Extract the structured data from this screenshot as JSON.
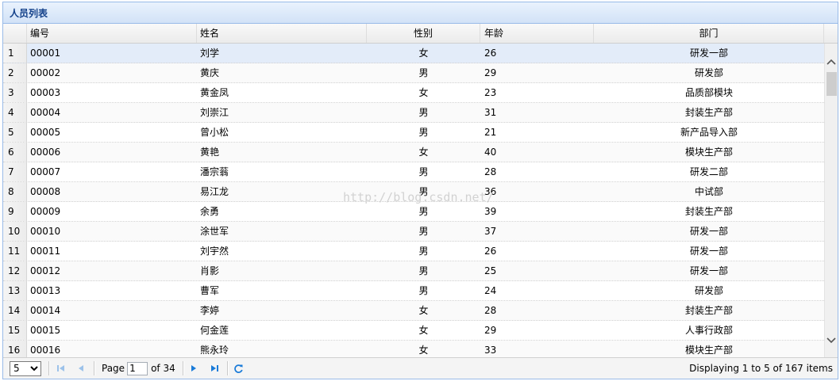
{
  "panel": {
    "title": "人员列表"
  },
  "columns": [
    {
      "key": "num",
      "label": ""
    },
    {
      "key": "id",
      "label": "编号"
    },
    {
      "key": "name",
      "label": "姓名"
    },
    {
      "key": "gender",
      "label": "性别"
    },
    {
      "key": "age",
      "label": "年龄"
    },
    {
      "key": "dept",
      "label": "部门"
    }
  ],
  "rows": [
    {
      "num": "1",
      "id": "00001",
      "name": "刘学",
      "gender": "女",
      "age": "26",
      "dept": "研发一部"
    },
    {
      "num": "2",
      "id": "00002",
      "name": "黄庆",
      "gender": "男",
      "age": "29",
      "dept": "研发部"
    },
    {
      "num": "3",
      "id": "00003",
      "name": "黄金凤",
      "gender": "女",
      "age": "23",
      "dept": "品质部模块"
    },
    {
      "num": "4",
      "id": "00004",
      "name": "刘崇江",
      "gender": "男",
      "age": "31",
      "dept": "封装生产部"
    },
    {
      "num": "5",
      "id": "00005",
      "name": "曾小松",
      "gender": "男",
      "age": "21",
      "dept": "新产品导入部"
    },
    {
      "num": "6",
      "id": "00006",
      "name": "黄艳",
      "gender": "女",
      "age": "40",
      "dept": "模块生产部"
    },
    {
      "num": "7",
      "id": "00007",
      "name": "潘宗蓊",
      "gender": "男",
      "age": "28",
      "dept": "研发二部"
    },
    {
      "num": "8",
      "id": "00008",
      "name": "易江龙",
      "gender": "男",
      "age": "36",
      "dept": "中试部"
    },
    {
      "num": "9",
      "id": "00009",
      "name": "余勇",
      "gender": "男",
      "age": "39",
      "dept": "封装生产部"
    },
    {
      "num": "10",
      "id": "00010",
      "name": "涂世军",
      "gender": "男",
      "age": "37",
      "dept": "研发一部"
    },
    {
      "num": "11",
      "id": "00011",
      "name": "刘宇然",
      "gender": "男",
      "age": "26",
      "dept": "研发一部"
    },
    {
      "num": "12",
      "id": "00012",
      "name": "肖影",
      "gender": "男",
      "age": "25",
      "dept": "研发一部"
    },
    {
      "num": "13",
      "id": "00013",
      "name": "曹军",
      "gender": "男",
      "age": "24",
      "dept": "研发部"
    },
    {
      "num": "14",
      "id": "00014",
      "name": "李婷",
      "gender": "女",
      "age": "28",
      "dept": "封装生产部"
    },
    {
      "num": "15",
      "id": "00015",
      "name": "何金莲",
      "gender": "女",
      "age": "29",
      "dept": "人事行政部"
    },
    {
      "num": "16",
      "id": "00016",
      "name": "熊永玲",
      "gender": "女",
      "age": "33",
      "dept": "模块生产部"
    }
  ],
  "selected_row": 0,
  "pager": {
    "page_size": "5",
    "page_size_options": [
      "5"
    ],
    "page_label": "Page",
    "page_value": "1",
    "of_label": "of 34",
    "display_text": "Displaying 1 to 5 of 167 items"
  },
  "icons": {
    "first": "first-page-icon",
    "prev": "prev-page-icon",
    "next": "next-page-icon",
    "last": "last-page-icon",
    "refresh": "refresh-icon"
  },
  "colors": {
    "header_title": "#15428b",
    "border": "#99bbe8",
    "selected_row": "#e3ecf9",
    "nav_active": "#1a7bd8",
    "nav_disabled": "#9cc2ea"
  },
  "watermark": "http://blog.csdn.net/"
}
